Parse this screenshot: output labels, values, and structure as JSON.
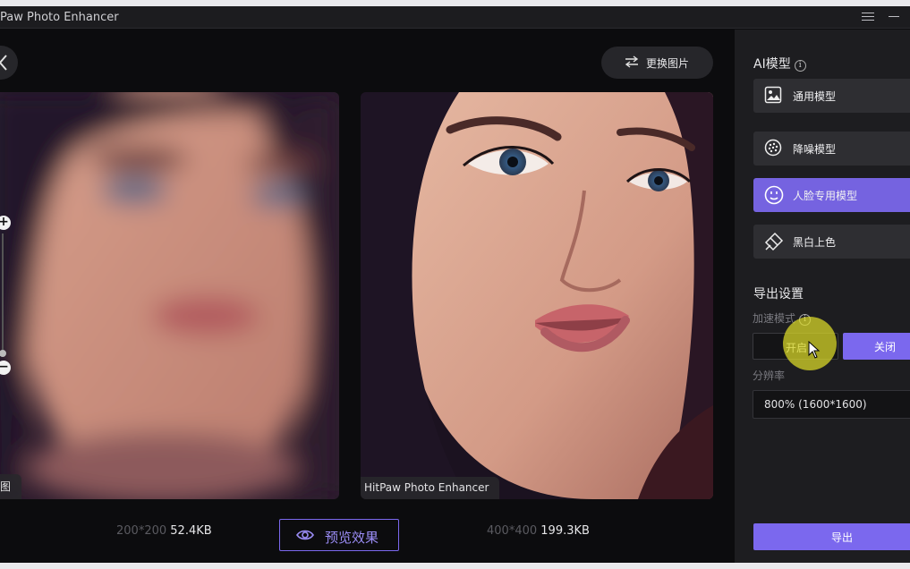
{
  "app": {
    "title": "Paw Photo Enhancer"
  },
  "toolbar": {
    "replace_label": "更换图片"
  },
  "images": {
    "left_label": "图",
    "right_label": "HitPaw Photo Enhancer",
    "left_dims": "200*200",
    "left_size": "52.4KB",
    "right_dims": "400*400",
    "right_size": "199.3KB"
  },
  "zoom": {
    "plus": "+",
    "minus": "−"
  },
  "preview": {
    "label": "预览效果"
  },
  "sidebar": {
    "ai_model_title": "AI模型",
    "models": [
      {
        "label": "通用模型",
        "icon": "image-icon",
        "active": false
      },
      {
        "label": "降噪模型",
        "icon": "denoise-icon",
        "active": false
      },
      {
        "label": "人脸专用模型",
        "icon": "face-icon",
        "active": true
      },
      {
        "label": "黑白上色",
        "icon": "colorize-icon",
        "active": false
      }
    ],
    "export_settings_title": "导出设置",
    "accel_label": "加速模式",
    "accel_on": "开启",
    "accel_off": "关闭",
    "accel_selected": "关闭",
    "resolution_label": "分辨率",
    "resolution_value": "800% (1600*1600)",
    "export_label": "导出"
  },
  "colors": {
    "accent": "#7b68ee",
    "active_model": "#7563e0",
    "panel": "#1d1d20",
    "background": "#0c0c0e"
  }
}
